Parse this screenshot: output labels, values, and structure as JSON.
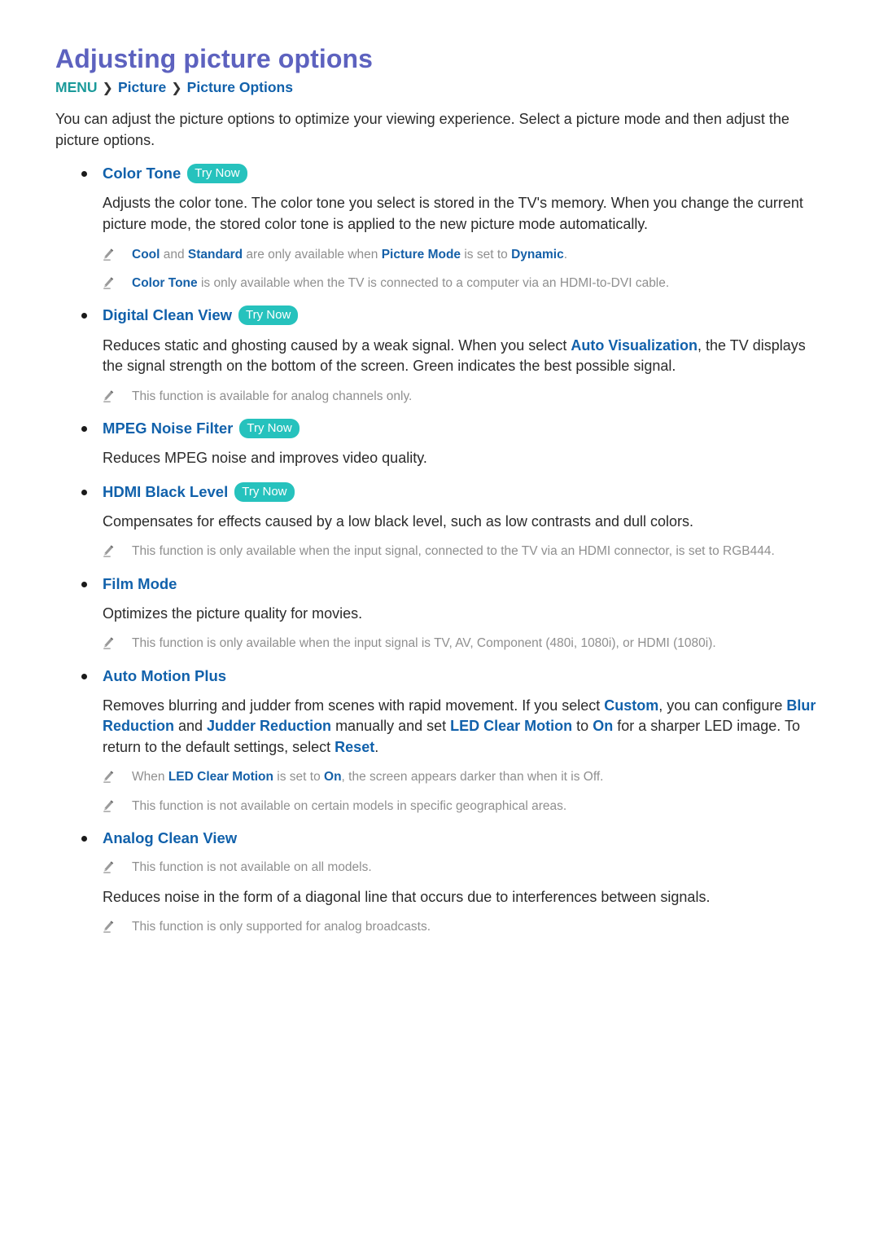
{
  "page": {
    "title": "Adjusting picture options",
    "breadcrumb": {
      "menu": "MENU",
      "separator": "❯",
      "level1": "Picture",
      "level2": "Picture Options"
    },
    "intro": "You can adjust the picture options to optimize your viewing experience. Select a picture mode and then adjust the picture options."
  },
  "colors": {
    "title": "#5d62bf",
    "menu_teal": "#1b9a9a",
    "link_blue": "#1161ab",
    "try_now_badge": "#26c2bd",
    "note_gray": "#8f8f8f",
    "body_text": "#2b2b2b"
  },
  "labels": {
    "try_now": "Try Now"
  },
  "sections": [
    {
      "id": "color-tone",
      "heading": "Color Tone",
      "try_now": true,
      "body": [
        "Adjusts the color tone. The color tone you select is stored in the TV's memory. When you change the current picture mode, the stored color tone is applied to the new picture mode automatically."
      ],
      "notes": [
        {
          "parts": [
            {
              "t": "Cool",
              "hl": true
            },
            {
              "t": " and ",
              "hl": false
            },
            {
              "t": "Standard",
              "hl": true
            },
            {
              "t": " are only available when ",
              "hl": false
            },
            {
              "t": "Picture Mode",
              "hl": true
            },
            {
              "t": " is set to ",
              "hl": false
            },
            {
              "t": "Dynamic",
              "hl": true
            },
            {
              "t": ".",
              "hl": false
            }
          ]
        },
        {
          "parts": [
            {
              "t": "Color Tone",
              "hl": true
            },
            {
              "t": " is only available when the TV is connected to a computer via an HDMI-to-DVI cable.",
              "hl": false
            }
          ]
        }
      ]
    },
    {
      "id": "digital-clean-view",
      "heading": "Digital Clean View",
      "try_now": true,
      "body_parts": [
        {
          "t": "Reduces static and ghosting caused by a weak signal. When you select ",
          "hl": false
        },
        {
          "t": "Auto Visualization",
          "hl": true
        },
        {
          "t": ", the TV displays the signal strength on the bottom of the screen. Green indicates the best possible signal.",
          "hl": false
        }
      ],
      "notes": [
        {
          "parts": [
            {
              "t": "This function is available for analog channels only.",
              "hl": false
            }
          ]
        }
      ]
    },
    {
      "id": "mpeg-noise-filter",
      "heading": "MPEG Noise Filter",
      "try_now": true,
      "body_parts": [
        {
          "t": "Reduces MPEG noise and improves video quality.",
          "hl": false
        }
      ],
      "notes": []
    },
    {
      "id": "hdmi-black-level",
      "heading": "HDMI Black Level",
      "try_now": true,
      "body_parts": [
        {
          "t": "Compensates for effects caused by a low black level, such as low contrasts and dull colors.",
          "hl": false
        }
      ],
      "notes": [
        {
          "parts": [
            {
              "t": "This function is only available when the input signal, connected to the TV via an HDMI connector, is set to RGB444.",
              "hl": false
            }
          ]
        }
      ]
    },
    {
      "id": "film-mode",
      "heading": "Film Mode",
      "try_now": false,
      "body_parts": [
        {
          "t": "Optimizes the picture quality for movies.",
          "hl": false
        }
      ],
      "notes": [
        {
          "parts": [
            {
              "t": "This function is only available when the input signal is TV, AV, Component (480i, 1080i), or HDMI (1080i).",
              "hl": false
            }
          ]
        }
      ]
    },
    {
      "id": "auto-motion-plus",
      "heading": "Auto Motion Plus",
      "try_now": false,
      "body_parts": [
        {
          "t": "Removes blurring and judder from scenes with rapid movement. If you select ",
          "hl": false
        },
        {
          "t": "Custom",
          "hl": true
        },
        {
          "t": ", you can configure ",
          "hl": false
        },
        {
          "t": "Blur Reduction",
          "hl": true
        },
        {
          "t": " and ",
          "hl": false
        },
        {
          "t": "Judder Reduction",
          "hl": true
        },
        {
          "t": " manually and set ",
          "hl": false
        },
        {
          "t": "LED Clear Motion",
          "hl": true
        },
        {
          "t": " to ",
          "hl": false
        },
        {
          "t": "On",
          "hl": true
        },
        {
          "t": " for a sharper LED image. To return to the default settings, select ",
          "hl": false
        },
        {
          "t": "Reset",
          "hl": true
        },
        {
          "t": ".",
          "hl": false
        }
      ],
      "notes": [
        {
          "parts": [
            {
              "t": "When ",
              "hl": false
            },
            {
              "t": "LED Clear Motion",
              "hl": true
            },
            {
              "t": " is set to ",
              "hl": false
            },
            {
              "t": "On",
              "hl": true
            },
            {
              "t": ", the screen appears darker than when it is Off.",
              "hl": false
            }
          ]
        },
        {
          "parts": [
            {
              "t": "This function is not available on certain models in specific geographical areas.",
              "hl": false
            }
          ]
        }
      ]
    },
    {
      "id": "analog-clean-view",
      "heading": "Analog Clean View",
      "try_now": false,
      "notes_before_body": [
        {
          "parts": [
            {
              "t": "This function is not available on all models.",
              "hl": false
            }
          ]
        }
      ],
      "body_parts": [
        {
          "t": "Reduces noise in the form of a diagonal line that occurs due to interferences between signals.",
          "hl": false
        }
      ],
      "notes": [
        {
          "parts": [
            {
              "t": "This function is only supported for analog broadcasts.",
              "hl": false
            }
          ]
        }
      ]
    }
  ]
}
